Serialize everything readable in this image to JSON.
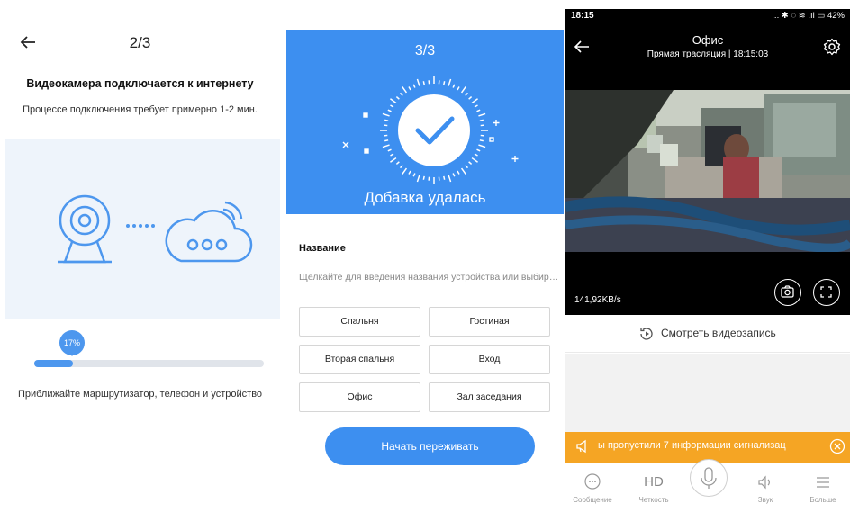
{
  "panel1": {
    "step": "2/3",
    "title": "Видеокамера подключается к интернету",
    "subtitle": "Процессе подключения требует примерно 1-2 мин.",
    "progress_label": "17%",
    "progress_fraction": 0.17,
    "hint": "Приближайте маршрутизатор, телефон и устройство"
  },
  "panel2": {
    "step": "3/3",
    "success": "Добавка удалась",
    "name_label": "Название",
    "name_placeholder": "Щелкайте для введения названия устройства или выбира...",
    "rooms": [
      "Спальня",
      "Гостиная",
      "Вторая спальня",
      "Вход",
      "Офис",
      "Зал заседания"
    ],
    "start_button": "Начать переживать"
  },
  "panel3": {
    "clock": "18:15",
    "status_icons": "... ✱ ◌ ≋ .ıl ▭ 42%",
    "title": "Офис",
    "live": "Прямая трасляция | 18:15:03",
    "speed": "141,92KB/s",
    "recording": "Смотреть видеозапись",
    "alarm": "ы пропустили 7 информации сигнализац",
    "nav": {
      "message": "Сообщение",
      "hd": "HD",
      "clarity": "Четкость",
      "sound": "Звук",
      "more": "Больше"
    }
  },
  "colors": {
    "accent_blue": "#3d8ff0",
    "alarm_orange": "#f5a524"
  }
}
